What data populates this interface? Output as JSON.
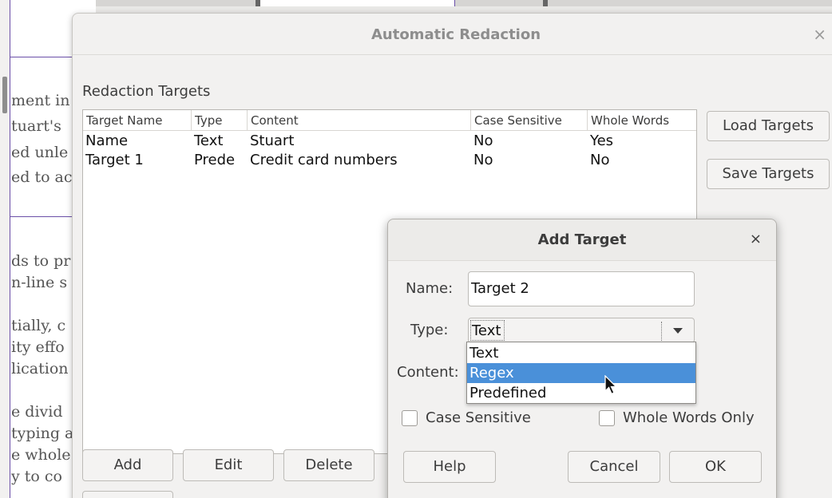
{
  "background_document": {
    "lines": [
      "ment in",
      "tuart's",
      "ed unle",
      "ed to ac",
      "ds to pr",
      "n-line s",
      "tially, c",
      "ity effo",
      "lication",
      "e divid",
      "typing a",
      "e whole",
      "y to co"
    ]
  },
  "main_dialog": {
    "title": "Automatic Redaction",
    "close_glyph": "×",
    "section_label": "Redaction Targets",
    "table": {
      "columns": [
        "Target Name",
        "Type",
        "Content",
        "Case Sensitive",
        "Whole Words"
      ],
      "rows": [
        [
          "Name",
          "Text",
          "Stuart",
          "No",
          "Yes"
        ],
        [
          "Target 1",
          "Prede",
          "Credit card numbers",
          "No",
          "No"
        ]
      ]
    },
    "side_buttons": {
      "load": "Load Targets",
      "save": "Save Targets"
    },
    "bottom_buttons": {
      "add": "Add",
      "edit": "Edit",
      "delete": "Delete"
    }
  },
  "add_target_dialog": {
    "title": "Add Target",
    "close_glyph": "×",
    "name_label": "Name:",
    "name_value": "Target 2",
    "type_label": "Type:",
    "type_value": "Text",
    "content_label": "Content:",
    "type_options": [
      "Text",
      "Regex",
      "Predefined"
    ],
    "highlighted_option": "Regex",
    "case_sensitive_label": "Case Sensitive",
    "case_sensitive_checked": false,
    "whole_words_label": "Whole Words Only",
    "whole_words_checked": false,
    "buttons": {
      "help": "Help",
      "cancel": "Cancel",
      "ok": "OK"
    }
  },
  "colors": {
    "selection": "#4a90d9",
    "document_frame": "#6a4fa8",
    "dialog_bg": "#f2f1f0"
  }
}
